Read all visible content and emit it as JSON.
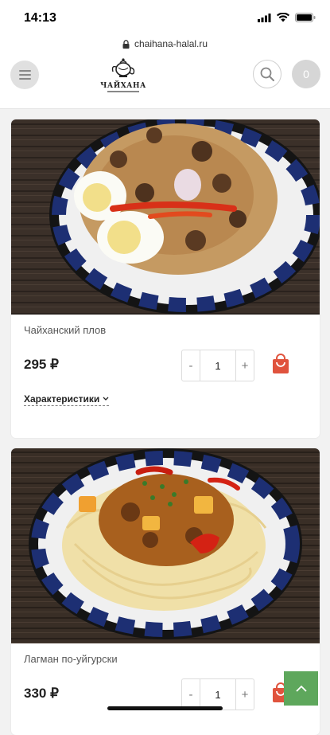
{
  "status_bar": {
    "time": "14:13"
  },
  "browser": {
    "url": "chaihana-halal.ru"
  },
  "header": {
    "logo_text": "ЧАЙХАНА",
    "cart_count": "0"
  },
  "products": [
    {
      "name": "Чайханский плов",
      "price": "295 ₽",
      "quantity": "1",
      "minus": "-",
      "plus": "+",
      "specs_label": "Характеристики"
    },
    {
      "name": "Лагман по-уйгурски",
      "price": "330 ₽",
      "quantity": "1",
      "minus": "-",
      "plus": "+"
    }
  ],
  "colors": {
    "accent": "#e0533d",
    "scroll_button": "#5ea75c"
  }
}
